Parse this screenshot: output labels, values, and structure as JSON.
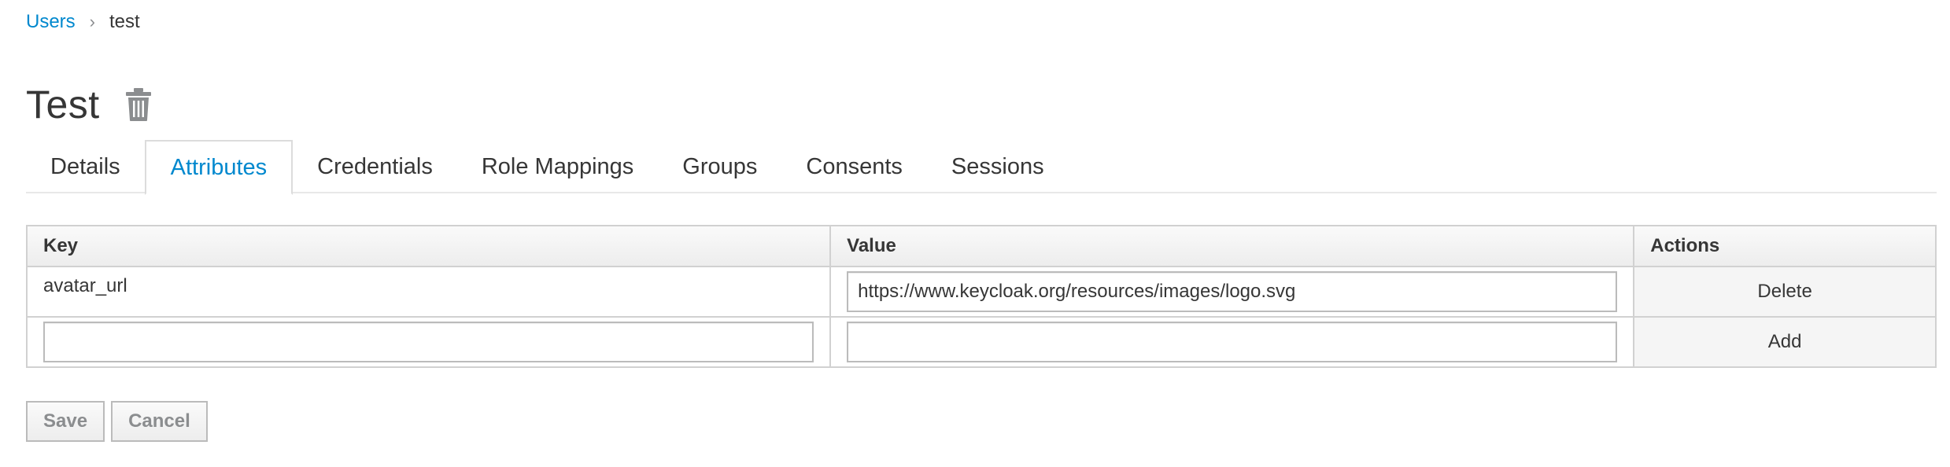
{
  "breadcrumb": {
    "parent": "Users",
    "separator": "›",
    "current": "test"
  },
  "header": {
    "title": "Test",
    "delete_icon": "trash-icon"
  },
  "tabs": [
    {
      "label": "Details",
      "active": false
    },
    {
      "label": "Attributes",
      "active": true
    },
    {
      "label": "Credentials",
      "active": false
    },
    {
      "label": "Role Mappings",
      "active": false
    },
    {
      "label": "Groups",
      "active": false
    },
    {
      "label": "Consents",
      "active": false
    },
    {
      "label": "Sessions",
      "active": false
    }
  ],
  "table": {
    "headers": {
      "key": "Key",
      "value": "Value",
      "actions": "Actions"
    },
    "rows": [
      {
        "key": "avatar_url",
        "value": "https://www.keycloak.org/resources/images/logo.svg",
        "action": "Delete"
      }
    ],
    "new_row": {
      "key": "",
      "value": "",
      "action": "Add"
    }
  },
  "footer": {
    "save_label": "Save",
    "cancel_label": "Cancel"
  },
  "colors": {
    "link": "#0088ce",
    "text": "#363636",
    "border": "#d1d1d1"
  }
}
